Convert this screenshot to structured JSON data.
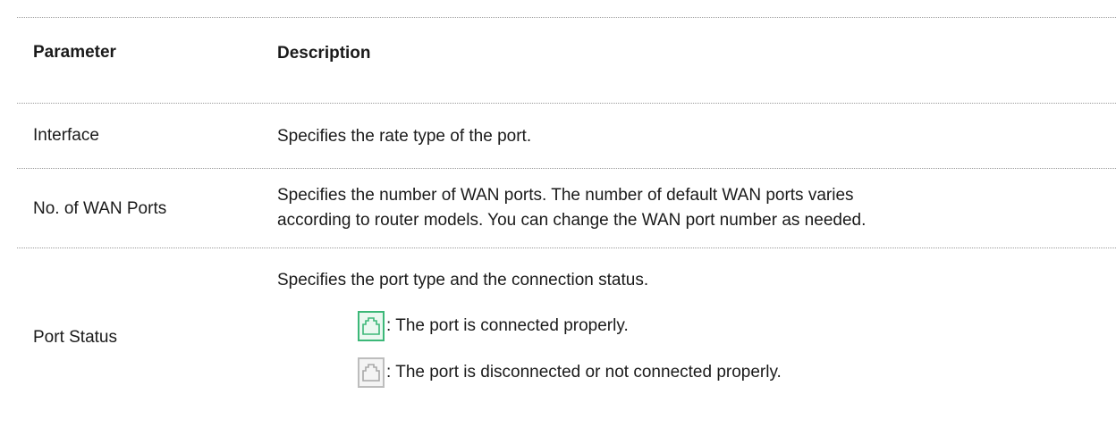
{
  "table": {
    "headers": {
      "parameter": "Parameter",
      "description": "Description"
    },
    "rows": [
      {
        "parameter": "Interface",
        "description": "Specifies the rate type of the port."
      },
      {
        "parameter": "No. of WAN Ports",
        "description_lines": [
          "Specifies the number of WAN ports. The number of default WAN ports varies",
          "according to router models. You can change the WAN port number as needed."
        ]
      },
      {
        "parameter": "Port Status",
        "description": "Specifies the port type and the connection status.",
        "statuses": [
          {
            "icon": "port-connected-icon",
            "color": "#3cb878",
            "text": ": The port is connected properly."
          },
          {
            "icon": "port-disconnected-icon",
            "color": "#bdbdbd",
            "text": ": The port is disconnected or not connected properly."
          }
        ]
      }
    ]
  }
}
